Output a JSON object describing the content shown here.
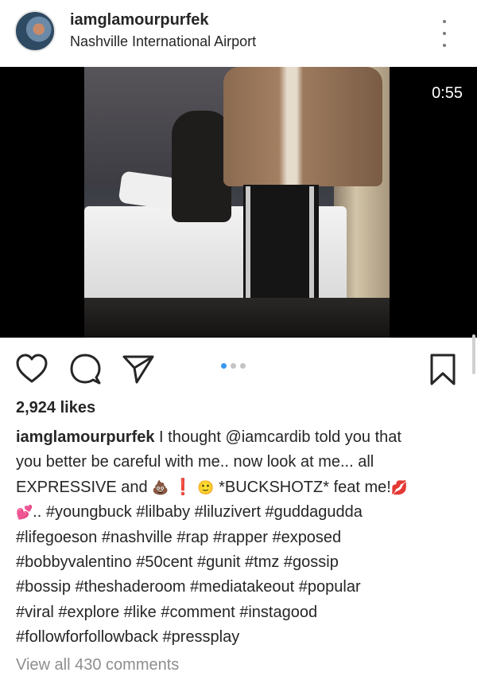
{
  "post": {
    "username": "iamglamourpurfek",
    "location": "Nashville International Airport",
    "video_duration": "0:55",
    "likes": "2,924 likes",
    "caption": {
      "user": "iamglamourpurfek",
      "line1": " I thought @iamcardib told you that",
      "line2": "you better be careful with me.. now look at me... all",
      "line3_a": "EXPRESSIVE and ",
      "emoji_poop": "💩",
      "line3_b": " ❗ ",
      "emoji_face": "🙂",
      "line3_c": " *BUCKSHOTZ* feat me!",
      "emoji_kiss": "💋",
      "emoji_hearts": "💕",
      "line4": ".. #youngbuck #lilbaby #liluzivert  #guddagudda",
      "line5": "#lifegoeson  #nashville #rap #rapper #exposed",
      "line6": "#bobbyvalentino  #50cent  #gunit  #tmz  #gossip",
      "line7": "#bossip #theshaderoom #mediatakeout #popular",
      "line8": "#viral #explore #like #comment #instagood",
      "line9": "#followforfollowback #pressplay"
    },
    "comments_link": "View all 430 comments",
    "carousel": {
      "count": 3,
      "active_index": 0
    }
  },
  "icons": {
    "like": "heart-icon",
    "comment": "comment-icon",
    "share": "send-icon",
    "save": "bookmark-icon",
    "more": "more-vertical-icon"
  },
  "colors": {
    "text": "#262626",
    "secondary": "#8e8e8e",
    "carousel_active": "#3897f0"
  }
}
